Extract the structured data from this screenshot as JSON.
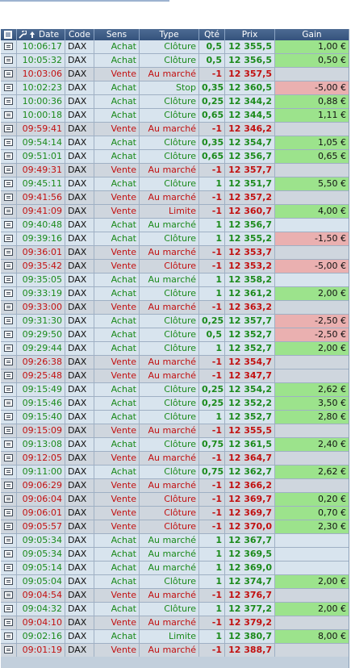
{
  "header": {
    "date": "Date",
    "code": "Code",
    "sens": "Sens",
    "type": "Type",
    "qte": "Qté",
    "prix": "Prix",
    "gain": "Gain",
    "icons": [
      "list-icon",
      "wrench-icon",
      "sort-up-icon"
    ]
  },
  "colors": {
    "buy": "#1b8a1b",
    "sell": "#c21010",
    "gain_positive": "#9ce38c",
    "gain_negative": "#eab0b0"
  },
  "rows": [
    {
      "time": "10:06:17",
      "code": "DAX",
      "sens": "Achat",
      "type": "Clôture",
      "qte": "0,5",
      "prix": "12 355,5",
      "gain": "1,00 €",
      "dir": "buy",
      "g": "pos"
    },
    {
      "time": "10:05:32",
      "code": "DAX",
      "sens": "Achat",
      "type": "Clôture",
      "qte": "0,5",
      "prix": "12 356,5",
      "gain": "0,50 €",
      "dir": "buy",
      "g": "pos"
    },
    {
      "time": "10:03:06",
      "code": "DAX",
      "sens": "Vente",
      "type": "Au marché",
      "qte": "-1",
      "prix": "12 357,5",
      "gain": "",
      "dir": "sell",
      "g": ""
    },
    {
      "time": "10:02:23",
      "code": "DAX",
      "sens": "Achat",
      "type": "Stop",
      "qte": "0,35",
      "prix": "12 360,5",
      "gain": "-5,00 €",
      "dir": "buy",
      "g": "neg"
    },
    {
      "time": "10:00:36",
      "code": "DAX",
      "sens": "Achat",
      "type": "Clôture",
      "qte": "0,25",
      "prix": "12 344,2",
      "gain": "0,88 €",
      "dir": "buy",
      "g": "pos"
    },
    {
      "time": "10:00:18",
      "code": "DAX",
      "sens": "Achat",
      "type": "Clôture",
      "qte": "0,65",
      "prix": "12 344,5",
      "gain": "1,11 €",
      "dir": "buy",
      "g": "pos"
    },
    {
      "time": "09:59:41",
      "code": "DAX",
      "sens": "Vente",
      "type": "Au marché",
      "qte": "-1",
      "prix": "12 346,2",
      "gain": "",
      "dir": "sell",
      "g": ""
    },
    {
      "time": "09:54:14",
      "code": "DAX",
      "sens": "Achat",
      "type": "Clôture",
      "qte": "0,35",
      "prix": "12 354,7",
      "gain": "1,05 €",
      "dir": "buy",
      "g": "pos"
    },
    {
      "time": "09:51:01",
      "code": "DAX",
      "sens": "Achat",
      "type": "Clôture",
      "qte": "0,65",
      "prix": "12 356,7",
      "gain": "0,65 €",
      "dir": "buy",
      "g": "pos"
    },
    {
      "time": "09:49:31",
      "code": "DAX",
      "sens": "Vente",
      "type": "Au marché",
      "qte": "-1",
      "prix": "12 357,7",
      "gain": "",
      "dir": "sell",
      "g": ""
    },
    {
      "time": "09:45:11",
      "code": "DAX",
      "sens": "Achat",
      "type": "Clôture",
      "qte": "1",
      "prix": "12 351,7",
      "gain": "5,50 €",
      "dir": "buy",
      "g": "pos"
    },
    {
      "time": "09:41:56",
      "code": "DAX",
      "sens": "Vente",
      "type": "Au marché",
      "qte": "-1",
      "prix": "12 357,2",
      "gain": "",
      "dir": "sell",
      "g": ""
    },
    {
      "time": "09:41:09",
      "code": "DAX",
      "sens": "Vente",
      "type": "Limite",
      "qte": "-1",
      "prix": "12 360,7",
      "gain": "4,00 €",
      "dir": "sell",
      "g": "pos"
    },
    {
      "time": "09:40:48",
      "code": "DAX",
      "sens": "Achat",
      "type": "Au marché",
      "qte": "1",
      "prix": "12 356,7",
      "gain": "",
      "dir": "buy",
      "g": ""
    },
    {
      "time": "09:39:16",
      "code": "DAX",
      "sens": "Achat",
      "type": "Clôture",
      "qte": "1",
      "prix": "12 355,2",
      "gain": "-1,50 €",
      "dir": "buy",
      "g": "neg"
    },
    {
      "time": "09:36:01",
      "code": "DAX",
      "sens": "Vente",
      "type": "Au marché",
      "qte": "-1",
      "prix": "12 353,7",
      "gain": "",
      "dir": "sell",
      "g": ""
    },
    {
      "time": "09:35:42",
      "code": "DAX",
      "sens": "Vente",
      "type": "Clôture",
      "qte": "-1",
      "prix": "12 353,2",
      "gain": "-5,00 €",
      "dir": "sell",
      "g": "neg"
    },
    {
      "time": "09:35:05",
      "code": "DAX",
      "sens": "Achat",
      "type": "Au marché",
      "qte": "1",
      "prix": "12 358,2",
      "gain": "",
      "dir": "buy",
      "g": ""
    },
    {
      "time": "09:33:19",
      "code": "DAX",
      "sens": "Achat",
      "type": "Clôture",
      "qte": "1",
      "prix": "12 361,2",
      "gain": "2,00 €",
      "dir": "buy",
      "g": "pos"
    },
    {
      "time": "09:33:00",
      "code": "DAX",
      "sens": "Vente",
      "type": "Au marché",
      "qte": "-1",
      "prix": "12 363,2",
      "gain": "",
      "dir": "sell",
      "g": ""
    },
    {
      "time": "09:31:30",
      "code": "DAX",
      "sens": "Achat",
      "type": "Clôture",
      "qte": "0,25",
      "prix": "12 357,7",
      "gain": "-2,50 €",
      "dir": "buy",
      "g": "neg"
    },
    {
      "time": "09:29:50",
      "code": "DAX",
      "sens": "Achat",
      "type": "Clôture",
      "qte": "0,5",
      "prix": "12 352,7",
      "gain": "-2,50 €",
      "dir": "buy",
      "g": "neg"
    },
    {
      "time": "09:29:44",
      "code": "DAX",
      "sens": "Achat",
      "type": "Clôture",
      "qte": "1",
      "prix": "12 352,7",
      "gain": "2,00 €",
      "dir": "buy",
      "g": "pos"
    },
    {
      "time": "09:26:38",
      "code": "DAX",
      "sens": "Vente",
      "type": "Au marché",
      "qte": "-1",
      "prix": "12 354,7",
      "gain": "",
      "dir": "sell",
      "g": ""
    },
    {
      "time": "09:25:48",
      "code": "DAX",
      "sens": "Vente",
      "type": "Au marché",
      "qte": "-1",
      "prix": "12 347,7",
      "gain": "",
      "dir": "sell",
      "g": ""
    },
    {
      "time": "09:15:49",
      "code": "DAX",
      "sens": "Achat",
      "type": "Clôture",
      "qte": "0,25",
      "prix": "12 354,2",
      "gain": "2,62 €",
      "dir": "buy",
      "g": "pos"
    },
    {
      "time": "09:15:46",
      "code": "DAX",
      "sens": "Achat",
      "type": "Clôture",
      "qte": "0,25",
      "prix": "12 352,2",
      "gain": "3,50 €",
      "dir": "buy",
      "g": "pos"
    },
    {
      "time": "09:15:40",
      "code": "DAX",
      "sens": "Achat",
      "type": "Clôture",
      "qte": "1",
      "prix": "12 352,7",
      "gain": "2,80 €",
      "dir": "buy",
      "g": "pos"
    },
    {
      "time": "09:15:09",
      "code": "DAX",
      "sens": "Vente",
      "type": "Au marché",
      "qte": "-1",
      "prix": "12 355,5",
      "gain": "",
      "dir": "sell",
      "g": ""
    },
    {
      "time": "09:13:08",
      "code": "DAX",
      "sens": "Achat",
      "type": "Clôture",
      "qte": "0,75",
      "prix": "12 361,5",
      "gain": "2,40 €",
      "dir": "buy",
      "g": "pos"
    },
    {
      "time": "09:12:05",
      "code": "DAX",
      "sens": "Vente",
      "type": "Au marché",
      "qte": "-1",
      "prix": "12 364,7",
      "gain": "",
      "dir": "sell",
      "g": ""
    },
    {
      "time": "09:11:00",
      "code": "DAX",
      "sens": "Achat",
      "type": "Clôture",
      "qte": "0,75",
      "prix": "12 362,7",
      "gain": "2,62 €",
      "dir": "buy",
      "g": "pos"
    },
    {
      "time": "09:06:29",
      "code": "DAX",
      "sens": "Vente",
      "type": "Au marché",
      "qte": "-1",
      "prix": "12 366,2",
      "gain": "",
      "dir": "sell",
      "g": ""
    },
    {
      "time": "09:06:04",
      "code": "DAX",
      "sens": "Vente",
      "type": "Clôture",
      "qte": "-1",
      "prix": "12 369,7",
      "gain": "0,20 €",
      "dir": "sell",
      "g": "pos"
    },
    {
      "time": "09:06:01",
      "code": "DAX",
      "sens": "Vente",
      "type": "Clôture",
      "qte": "-1",
      "prix": "12 369,7",
      "gain": "0,70 €",
      "dir": "sell",
      "g": "pos"
    },
    {
      "time": "09:05:57",
      "code": "DAX",
      "sens": "Vente",
      "type": "Clôture",
      "qte": "-1",
      "prix": "12 370,0",
      "gain": "2,30 €",
      "dir": "sell",
      "g": "pos"
    },
    {
      "time": "09:05:34",
      "code": "DAX",
      "sens": "Achat",
      "type": "Au marché",
      "qte": "1",
      "prix": "12 367,7",
      "gain": "",
      "dir": "buy",
      "g": ""
    },
    {
      "time": "09:05:34",
      "code": "DAX",
      "sens": "Achat",
      "type": "Au marché",
      "qte": "1",
      "prix": "12 369,5",
      "gain": "",
      "dir": "buy",
      "g": ""
    },
    {
      "time": "09:05:14",
      "code": "DAX",
      "sens": "Achat",
      "type": "Au marché",
      "qte": "1",
      "prix": "12 369,0",
      "gain": "",
      "dir": "buy",
      "g": ""
    },
    {
      "time": "09:05:04",
      "code": "DAX",
      "sens": "Achat",
      "type": "Clôture",
      "qte": "1",
      "prix": "12 374,7",
      "gain": "2,00 €",
      "dir": "buy",
      "g": "pos"
    },
    {
      "time": "09:04:54",
      "code": "DAX",
      "sens": "Vente",
      "type": "Au marché",
      "qte": "-1",
      "prix": "12 376,7",
      "gain": "",
      "dir": "sell",
      "g": ""
    },
    {
      "time": "09:04:32",
      "code": "DAX",
      "sens": "Achat",
      "type": "Clôture",
      "qte": "1",
      "prix": "12 377,2",
      "gain": "2,00 €",
      "dir": "buy",
      "g": "pos"
    },
    {
      "time": "09:04:10",
      "code": "DAX",
      "sens": "Vente",
      "type": "Au marché",
      "qte": "-1",
      "prix": "12 379,2",
      "gain": "",
      "dir": "sell",
      "g": ""
    },
    {
      "time": "09:02:16",
      "code": "DAX",
      "sens": "Achat",
      "type": "Limite",
      "qte": "1",
      "prix": "12 380,7",
      "gain": "8,00 €",
      "dir": "buy",
      "g": "pos"
    },
    {
      "time": "09:01:19",
      "code": "DAX",
      "sens": "Vente",
      "type": "Au marché",
      "qte": "-1",
      "prix": "12 388,7",
      "gain": "",
      "dir": "sell",
      "g": ""
    }
  ]
}
